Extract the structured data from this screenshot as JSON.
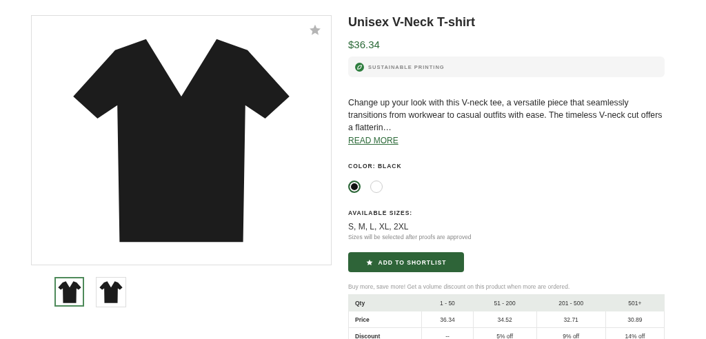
{
  "product": {
    "title": "Unisex V-Neck T-shirt",
    "price": "$36.34",
    "badge": "SUSTAINABLE PRINTING",
    "description": "Change up your look with this V-neck tee, a versatile piece that seamlessly transitions from workwear to casual outfits with ease. The timeless V-neck cut offers a flatterin…",
    "read_more": "READ MORE"
  },
  "thumbnails": [
    {
      "selected": true
    },
    {
      "selected": false
    }
  ],
  "color_label": "COLOR: BLACK",
  "swatches": [
    {
      "color": "#111111",
      "selected": true
    },
    {
      "color": "#ffffff",
      "selected": false
    }
  ],
  "sizes_label": "AVAILABLE SIZES:",
  "sizes": "S, M, L, XL, 2XL",
  "sizes_note": "Sizes will be selected after proofs are approved",
  "shortlist_button": "ADD TO SHORTLIST",
  "volume_note": "Buy more, save more! Get a volume discount on this product when more are ordered.",
  "table": {
    "columns": [
      "Qty",
      "1 - 50",
      "51 - 200",
      "201 - 500",
      "501+"
    ],
    "rows": [
      [
        "Price",
        "36.34",
        "34.52",
        "32.71",
        "30.89"
      ],
      [
        "Discount",
        "--",
        "5% off",
        "9% off",
        "14% off"
      ]
    ]
  }
}
